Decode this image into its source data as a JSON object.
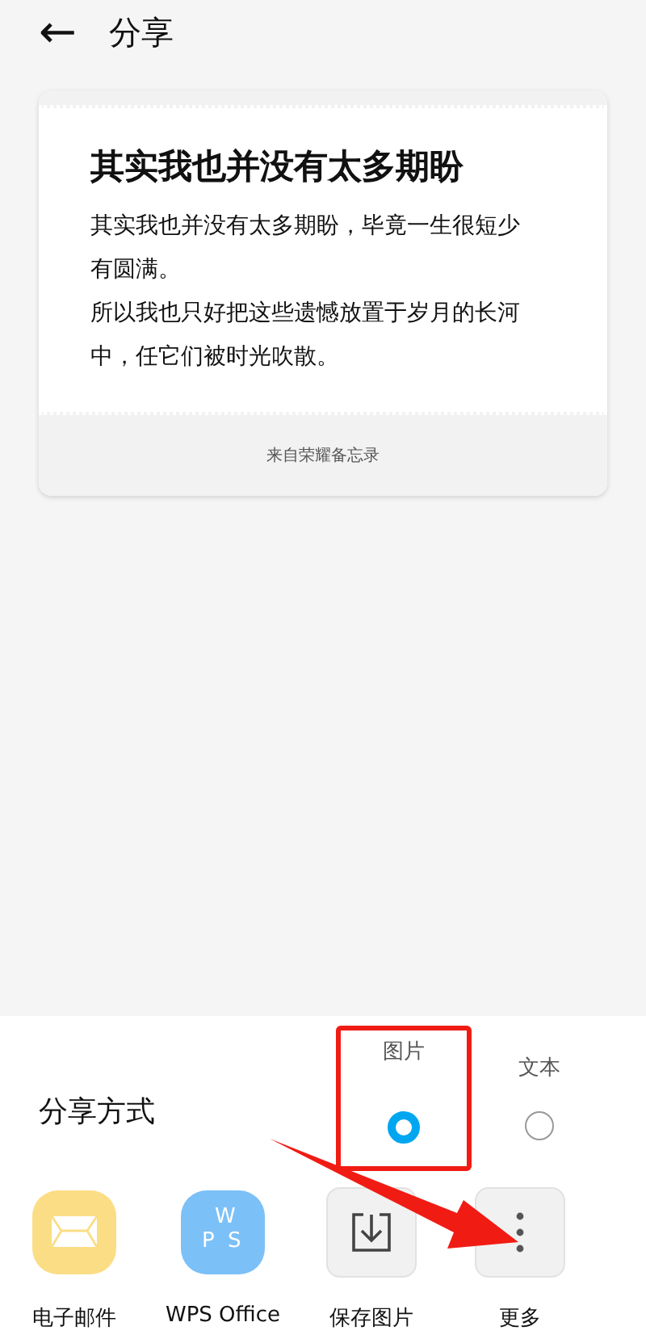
{
  "header": {
    "back": "←",
    "title": "分享"
  },
  "card": {
    "title": "其实我也并没有太多期盼",
    "paragraphs": [
      "其实我也并没有太多期盼，毕竟一生很短少有圆满。",
      "所以我也只好把这些遗憾放置于岁月的长河中，任它们被时光吹散。"
    ],
    "footer": "来自荣耀备忘录"
  },
  "share_panel": {
    "label": "分享方式",
    "options": [
      {
        "label": "图片",
        "selected": true,
        "highlighted": true
      },
      {
        "label": "文本",
        "selected": false,
        "highlighted": false
      }
    ],
    "apps": [
      {
        "kind": "mail",
        "label": "电子邮件"
      },
      {
        "kind": "wps",
        "label": "WPS Office",
        "icon_letters": [
          "W",
          "P",
          "S"
        ]
      },
      {
        "kind": "save",
        "label": "保存图片"
      },
      {
        "kind": "more",
        "label": "更多",
        "pointed": true
      }
    ]
  }
}
